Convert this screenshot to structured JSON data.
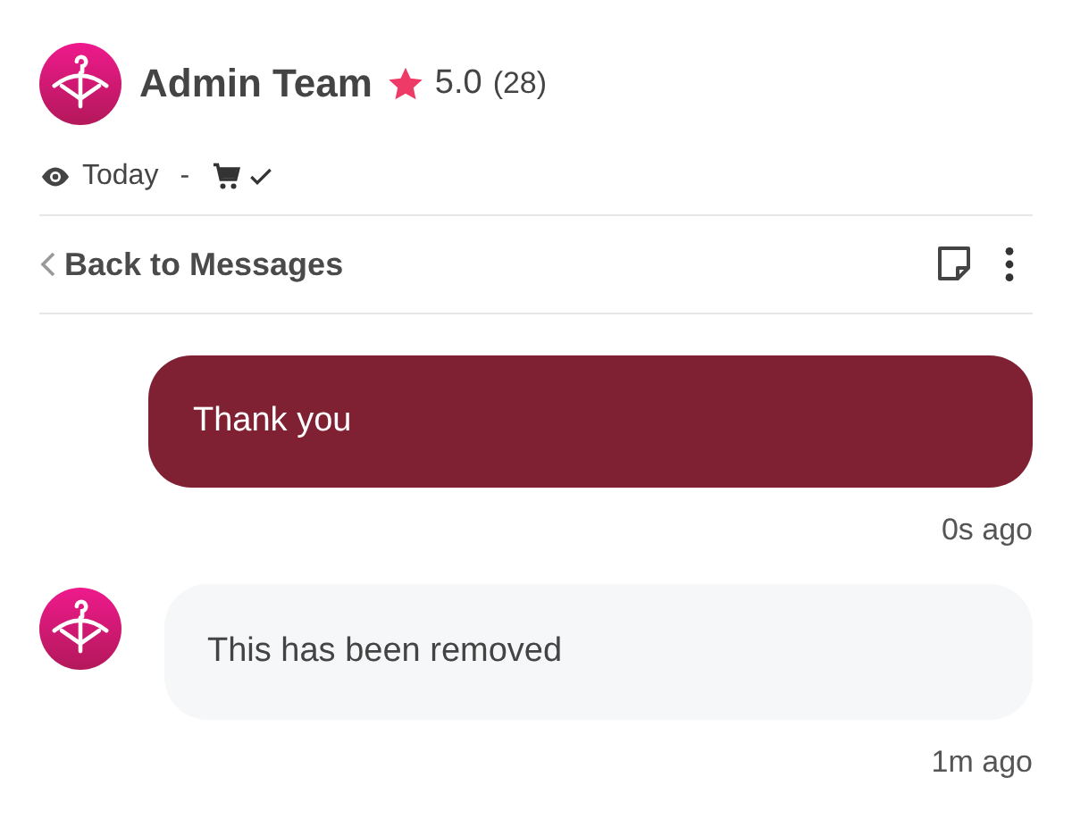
{
  "header": {
    "name": "Admin Team",
    "rating": "5.0",
    "reviews": "(28)",
    "seen": "Today",
    "separator": "-"
  },
  "toolbar": {
    "back": "Back to Messages"
  },
  "messages": [
    {
      "kind": "sent",
      "text": "Thank you",
      "time": "0s ago"
    },
    {
      "kind": "received",
      "text": "This has been removed",
      "time": "1m ago"
    }
  ]
}
